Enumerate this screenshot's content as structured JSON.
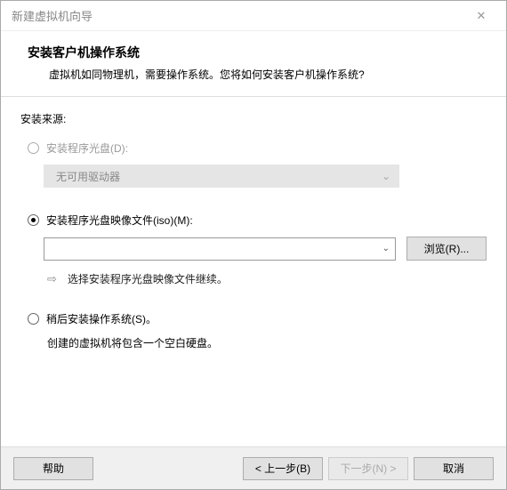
{
  "window": {
    "title": "新建虚拟机向导"
  },
  "header": {
    "title": "安装客户机操作系统",
    "subtitle": "虚拟机如同物理机，需要操作系统。您将如何安装客户机操作系统?"
  },
  "source": {
    "label": "安装来源:",
    "disc": {
      "label": "安装程序光盘(D):",
      "dropdown": "无可用驱动器"
    },
    "iso": {
      "label": "安装程序光盘映像文件(iso)(M):",
      "value": "",
      "browse": "浏览(R)...",
      "hint": "选择安装程序光盘映像文件继续。"
    },
    "later": {
      "label": "稍后安装操作系统(S)。",
      "sub": "创建的虚拟机将包含一个空白硬盘。"
    }
  },
  "footer": {
    "help": "帮助",
    "back": "< 上一步(B)",
    "next": "下一步(N) >",
    "cancel": "取消"
  }
}
